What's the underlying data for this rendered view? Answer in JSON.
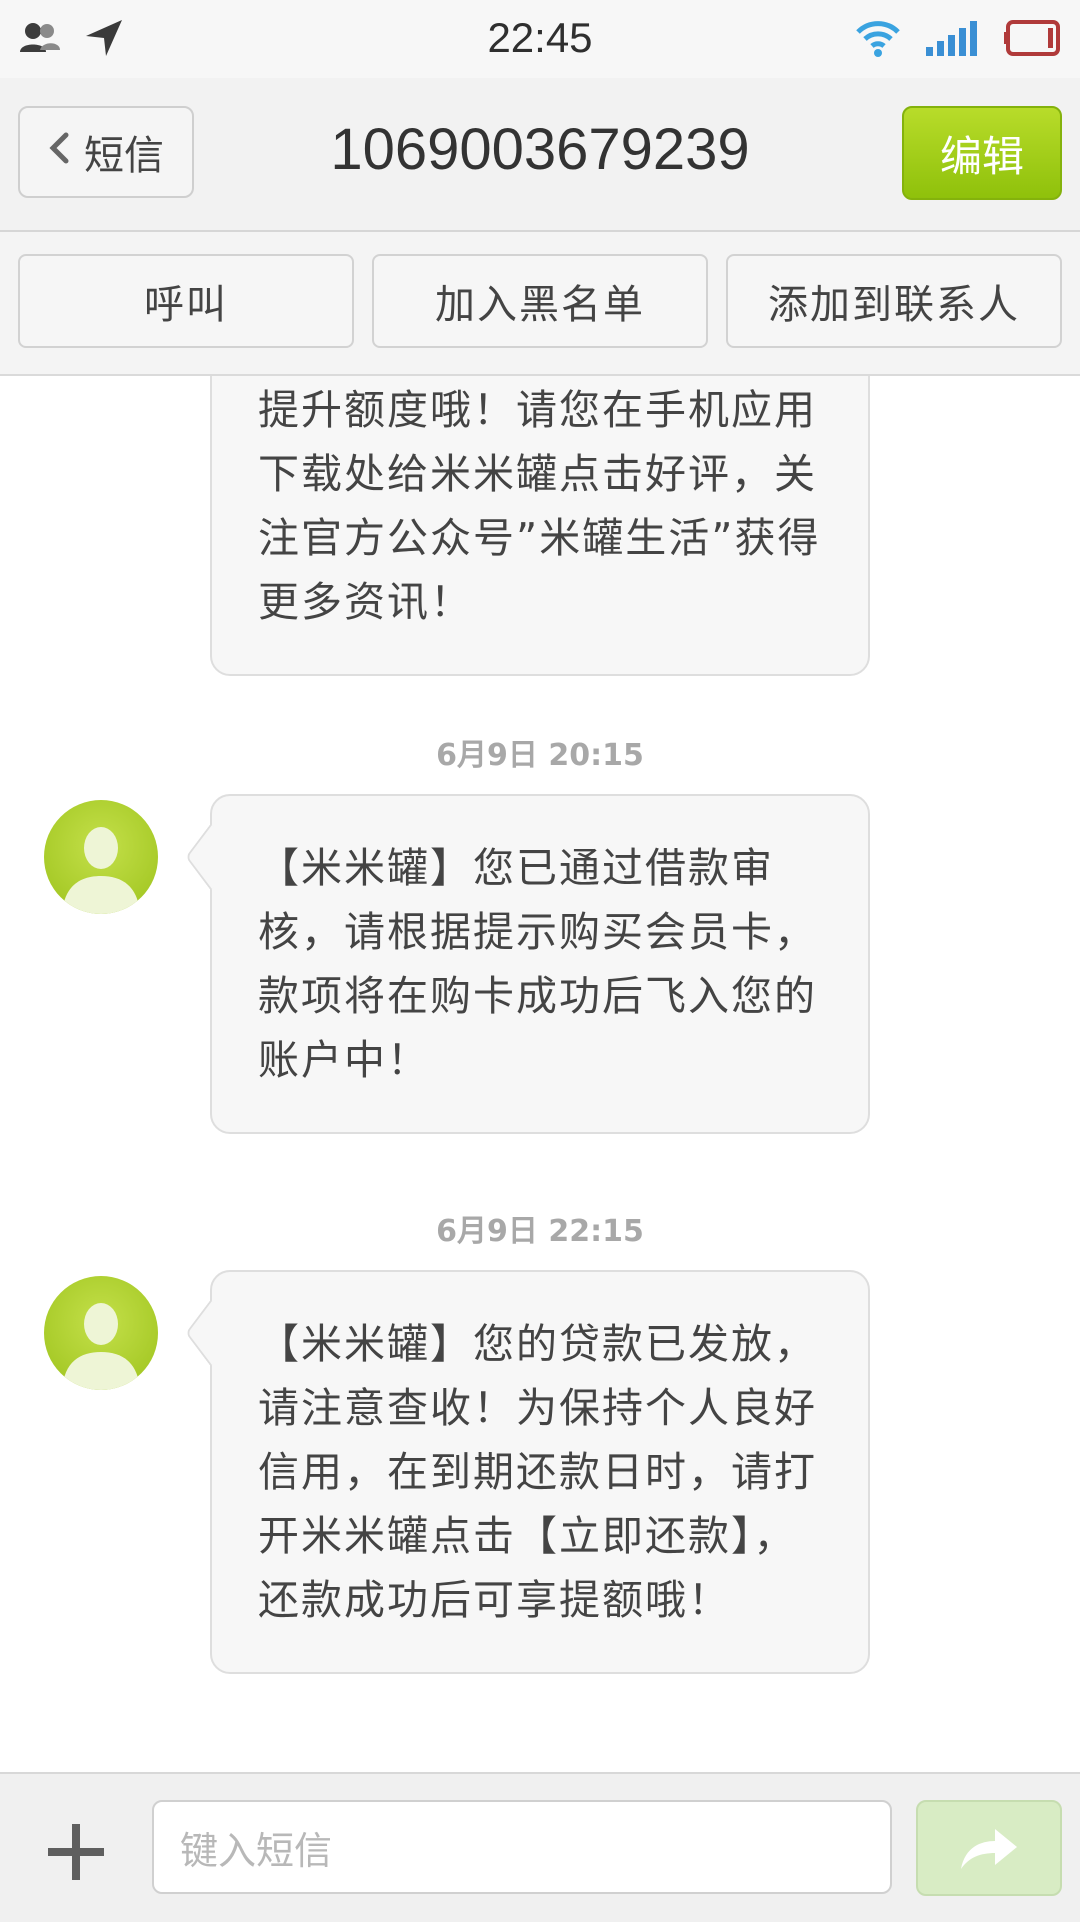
{
  "status_bar": {
    "time": "22:45",
    "icons_left": [
      "contacts-icon",
      "location-arrow-icon"
    ],
    "icons_right": [
      "wifi-icon",
      "signal-icon",
      "battery-icon"
    ]
  },
  "header": {
    "back_label": "短信",
    "title": "1069003679239",
    "edit_label": "编辑"
  },
  "actions": {
    "call": "呼叫",
    "blacklist": "加入黑名单",
    "add_contact": "添加到联系人"
  },
  "messages": [
    {
      "text": "提升额度哦！请您在手机应用下载处给米米罐点击好评，关注官方公众号”米罐生活”获得更多资讯！"
    },
    {
      "timestamp": "6月9日 20:15",
      "text": "【米米罐】您已通过借款审核，请根据提示购买会员卡，款项将在购卡成功后飞入您的账户中！"
    },
    {
      "timestamp": "6月9日 22:15",
      "text": "【米米罐】您的贷款已发放，请注意查收！为保持个人良好信用，在到期还款日时，请打开米米罐点击【立即还款】，还款成功后可享提额哦！"
    }
  ],
  "input": {
    "placeholder": "键入短信"
  },
  "colors": {
    "accent_green": "#9cc71a",
    "send_disabled": "#d8ecc4"
  }
}
